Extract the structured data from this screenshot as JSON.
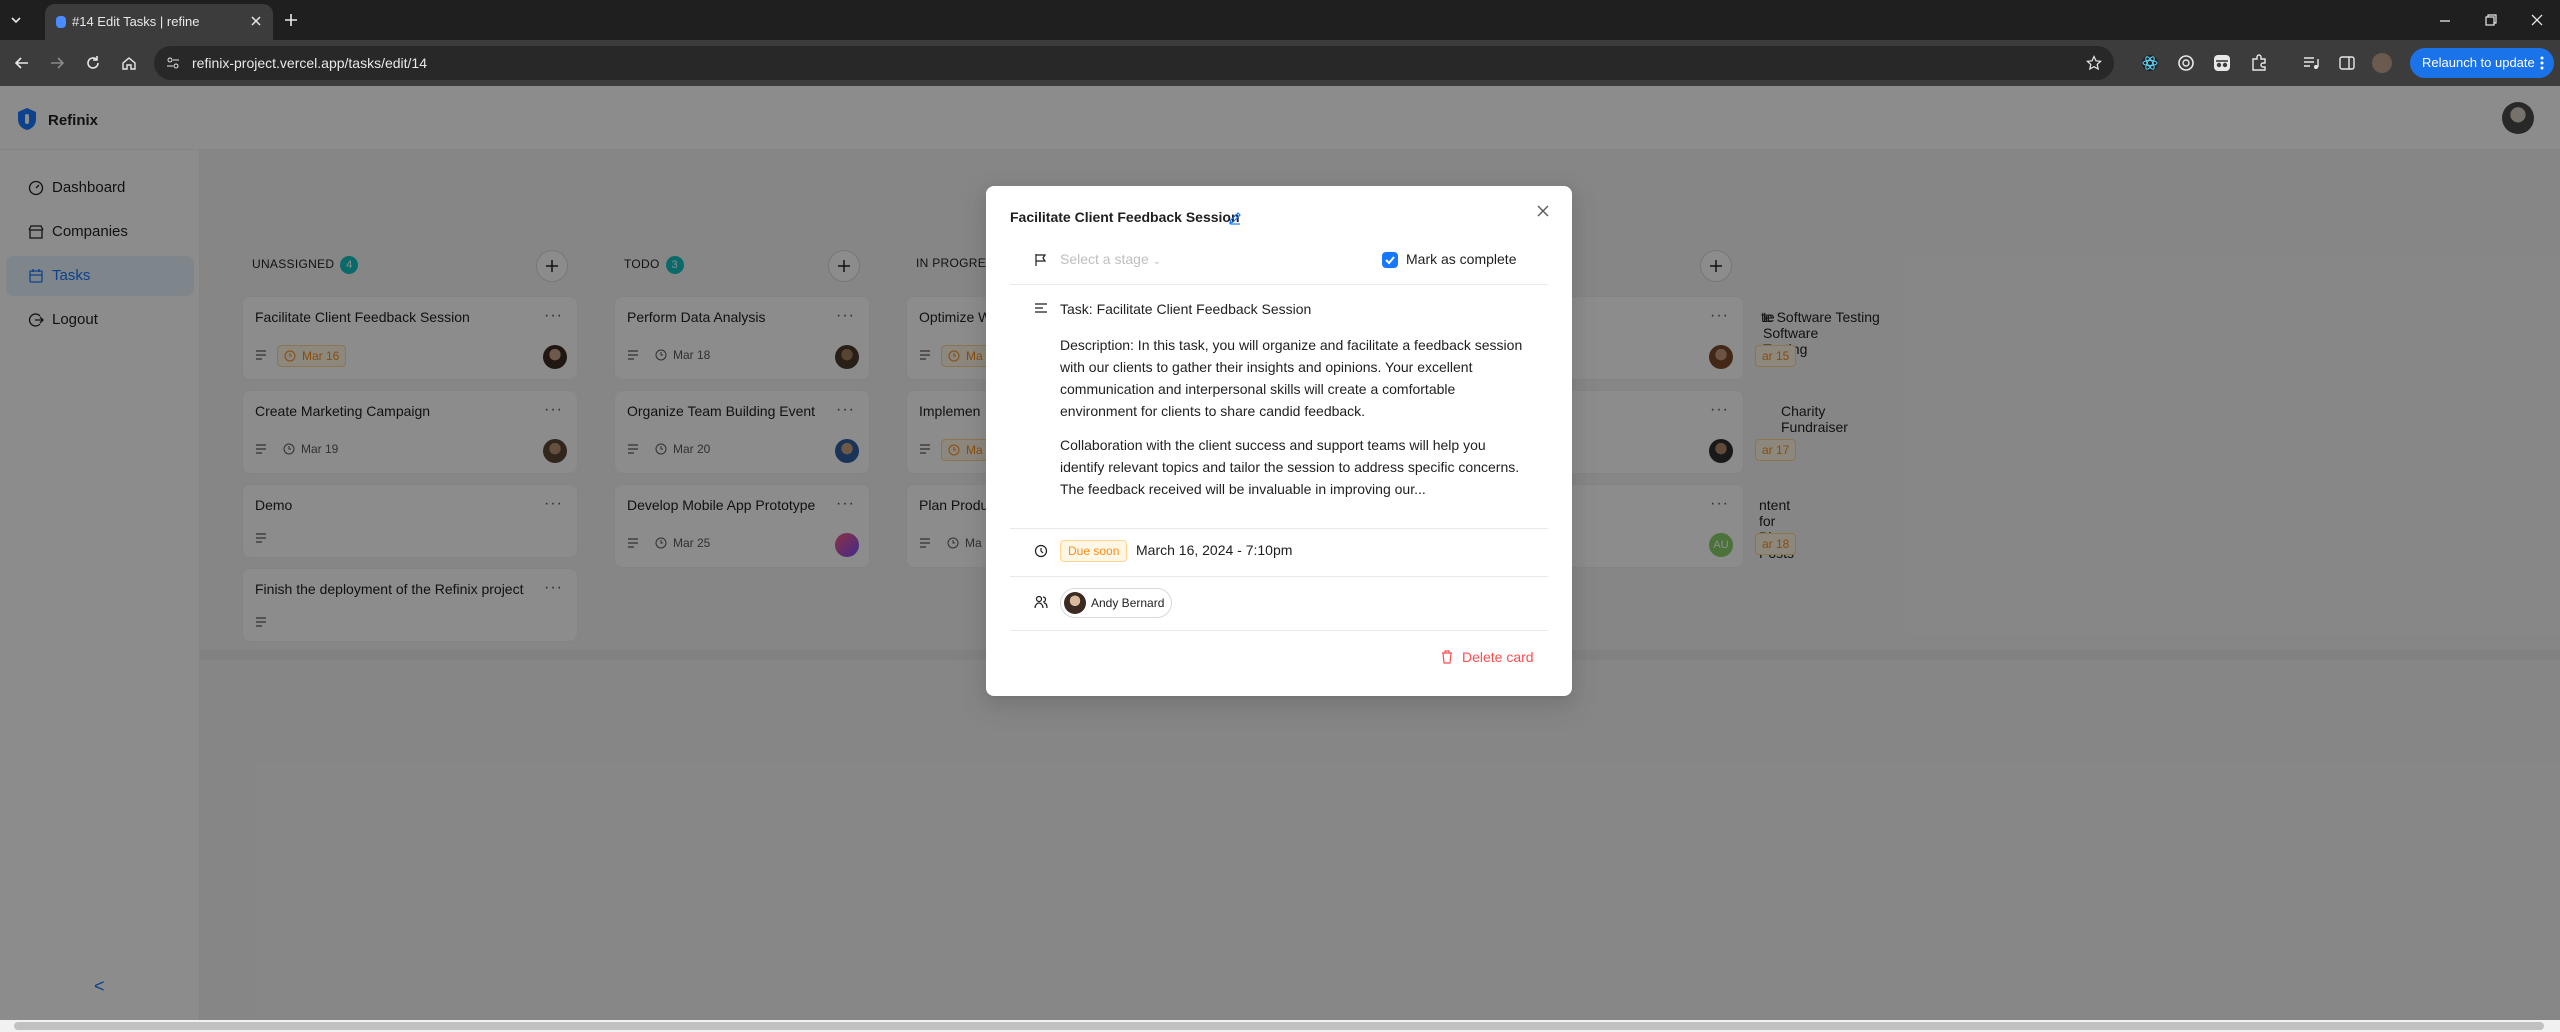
{
  "browser": {
    "tab_title": "#14 Edit Tasks | refine",
    "url": "refinix-project.vercel.app/tasks/edit/14",
    "relaunch_label": "Relaunch to update"
  },
  "app": {
    "name": "Refinix",
    "sidebar": {
      "items": [
        {
          "label": "Dashboard",
          "icon": "dashboard-icon"
        },
        {
          "label": "Companies",
          "icon": "shop-icon"
        },
        {
          "label": "Tasks",
          "icon": "calendar-icon",
          "active": true
        },
        {
          "label": "Logout",
          "icon": "logout-icon"
        }
      ],
      "collapse": "<"
    }
  },
  "board": {
    "columns": [
      {
        "title": "UNASSIGNED",
        "count": "4",
        "cards": [
          {
            "title": "Facilitate Client Feedback Session",
            "date": "Mar 16",
            "date_style": "warn"
          },
          {
            "title": "Create Marketing Campaign",
            "date": "Mar 19",
            "date_style": "plain"
          },
          {
            "title": "Demo",
            "date": ""
          },
          {
            "title": "Finish the deployment of the Refinix project",
            "date": ""
          }
        ]
      },
      {
        "title": "TODO",
        "count": "3",
        "cards": [
          {
            "title": "Perform Data Analysis",
            "date": "Mar 18",
            "date_style": "plain"
          },
          {
            "title": "Organize Team Building Event",
            "date": "Mar 20",
            "date_style": "plain"
          },
          {
            "title": "Develop Mobile App Prototype",
            "date": "Mar 25",
            "date_style": "plain"
          }
        ]
      },
      {
        "title": "IN PROGRESS",
        "cards": [
          {
            "title": "Optimize W",
            "date": "Ma",
            "date_style": "warn"
          },
          {
            "title": "Implemen",
            "date": "Ma",
            "date_style": "warn"
          },
          {
            "title": "Plan Produ",
            "date": "Ma",
            "date_style": "plain"
          }
        ]
      },
      {
        "cards": [
          {
            "title": "te Software Testing",
            "date": "ar 15",
            "date_style": "warn",
            "avatar_initials": ""
          },
          {
            "title": "Charity Fundraiser",
            "date": "ar 17",
            "date_style": "warn",
            "avatar_initials": ""
          },
          {
            "title": "ntent for Blog Posts",
            "date": "ar 18",
            "date_style": "warn",
            "avatar_initials": "AU"
          }
        ]
      }
    ]
  },
  "modal": {
    "title": "Facilitate Client Feedback Session",
    "stage_placeholder": "Select a stage",
    "mark_complete_label": "Mark as complete",
    "mark_complete_checked": true,
    "task_line": "Task: Facilitate Client Feedback Session",
    "description_p1": "Description: In this task, you will organize and facilitate a feedback session with our clients to gather their insights and opinions. Your excellent communication and interpersonal skills will create a comfortable environment for clients to share candid feedback.",
    "description_p2": "Collaboration with the client success and support teams will help you identify relevant topics and tailor the session to address specific concerns. The feedback received will be invaluable in improving our...",
    "due_tag": "Due soon",
    "due_date": "March 16, 2024 - 7:10pm",
    "assignee": "Andy Bernard",
    "delete_label": "Delete card"
  },
  "colors": {
    "primary": "#1677ff",
    "warn": "#fa8c16",
    "danger": "#ff4d4f",
    "badge": "#13c2c2"
  }
}
